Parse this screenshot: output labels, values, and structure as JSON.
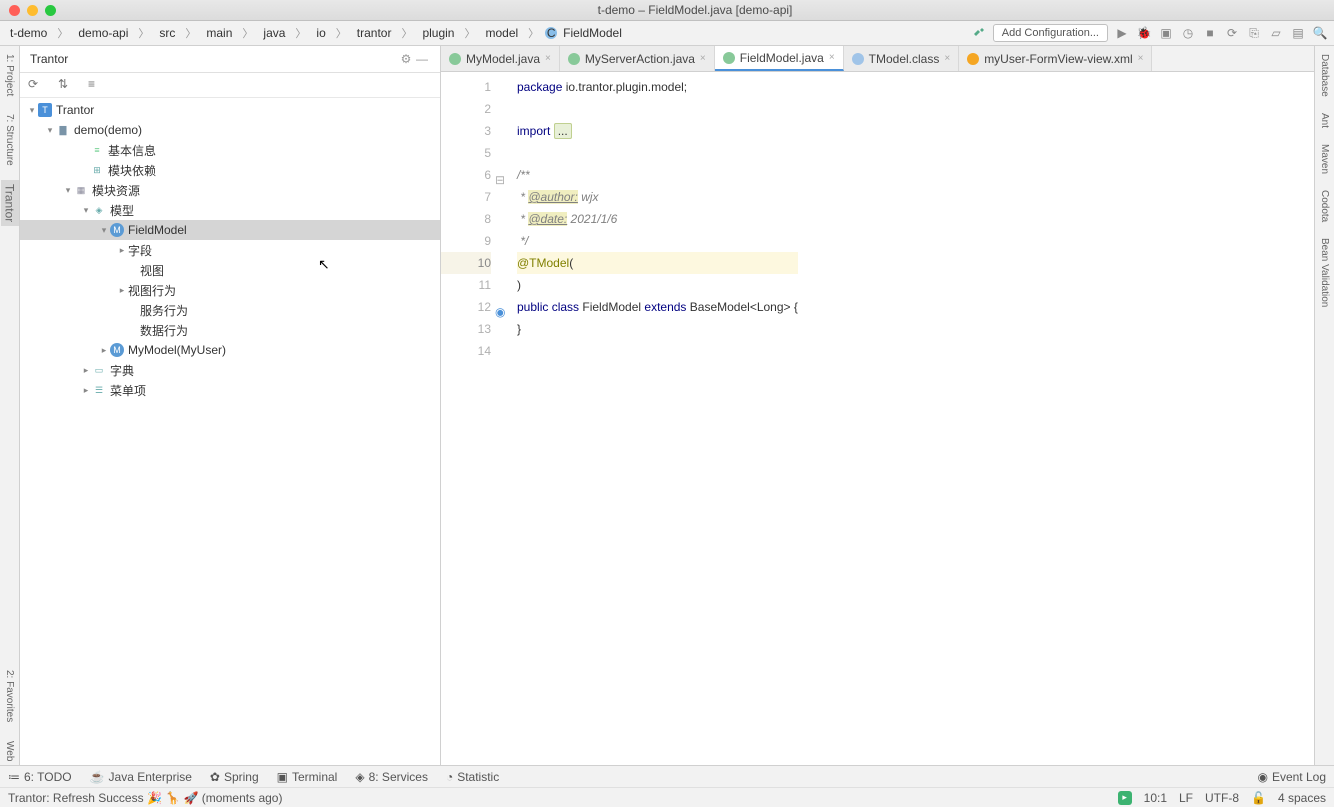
{
  "titlebar": {
    "title": "t-demo – FieldModel.java [demo-api]"
  },
  "breadcrumbs": [
    "t-demo",
    "demo-api",
    "src",
    "main",
    "java",
    "io",
    "trantor",
    "plugin",
    "model",
    "FieldModel"
  ],
  "addConfig": "Add Configuration...",
  "sidepanel": {
    "title": "Trantor",
    "tree": {
      "root": "Trantor",
      "demo": "demo(demo)",
      "basic": "基本信息",
      "dep": "模块依赖",
      "res": "模块资源",
      "models": "模型",
      "fieldModel": "FieldModel",
      "fields": "字段",
      "views": "视图",
      "viewAct": "视图行为",
      "svcAct": "服务行为",
      "dataAct": "数据行为",
      "myModel": "MyModel(MyUser)",
      "dict": "字典",
      "menu": "菜单项"
    }
  },
  "leftTabs": {
    "project": "1: Project",
    "structure": "7: Structure",
    "trantor": "Trantor",
    "favorites": "2: Favorites",
    "web": "Web"
  },
  "editorTabs": [
    {
      "label": "MyModel.java",
      "icon": "c"
    },
    {
      "label": "MyServerAction.java",
      "icon": "c"
    },
    {
      "label": "FieldModel.java",
      "icon": "c",
      "active": true
    },
    {
      "label": "TModel.class",
      "icon": "j"
    },
    {
      "label": "myUser-FormView-view.xml",
      "icon": "x"
    }
  ],
  "code": {
    "l1a": "package",
    "l1b": " io.trantor.plugin.model;",
    "l3": "import ",
    "l3f": "...",
    "l6a": "/**",
    "l7a": " * ",
    "l7b": "@author:",
    "l7c": " wjx",
    "l8a": " * ",
    "l8b": "@date:",
    "l8c": " 2021/1/6",
    "l9": " */",
    "l10a": "@TModel",
    "l10b": "(",
    "l11": ")",
    "l12a": "public ",
    "l12b": "class ",
    "l12c": "FieldModel ",
    "l12d": "extends ",
    "l12e": "BaseModel<Long> {",
    "l13": "}"
  },
  "rightTabs": {
    "database": "Database",
    "ant": "Ant",
    "maven": "Maven",
    "codota": "Codota",
    "bean": "Bean Validation"
  },
  "bottom": {
    "todo": "6: TODO",
    "java": "Java Enterprise",
    "spring": "Spring",
    "terminal": "Terminal",
    "services": "8: Services",
    "statistic": "Statistic",
    "eventlog": "Event Log"
  },
  "status": {
    "msg": "Trantor: Refresh Success 🎉 🦒 🚀 (moments ago)",
    "pos": "10:1",
    "lf": "LF",
    "enc": "UTF-8",
    "indent": "4 spaces"
  }
}
